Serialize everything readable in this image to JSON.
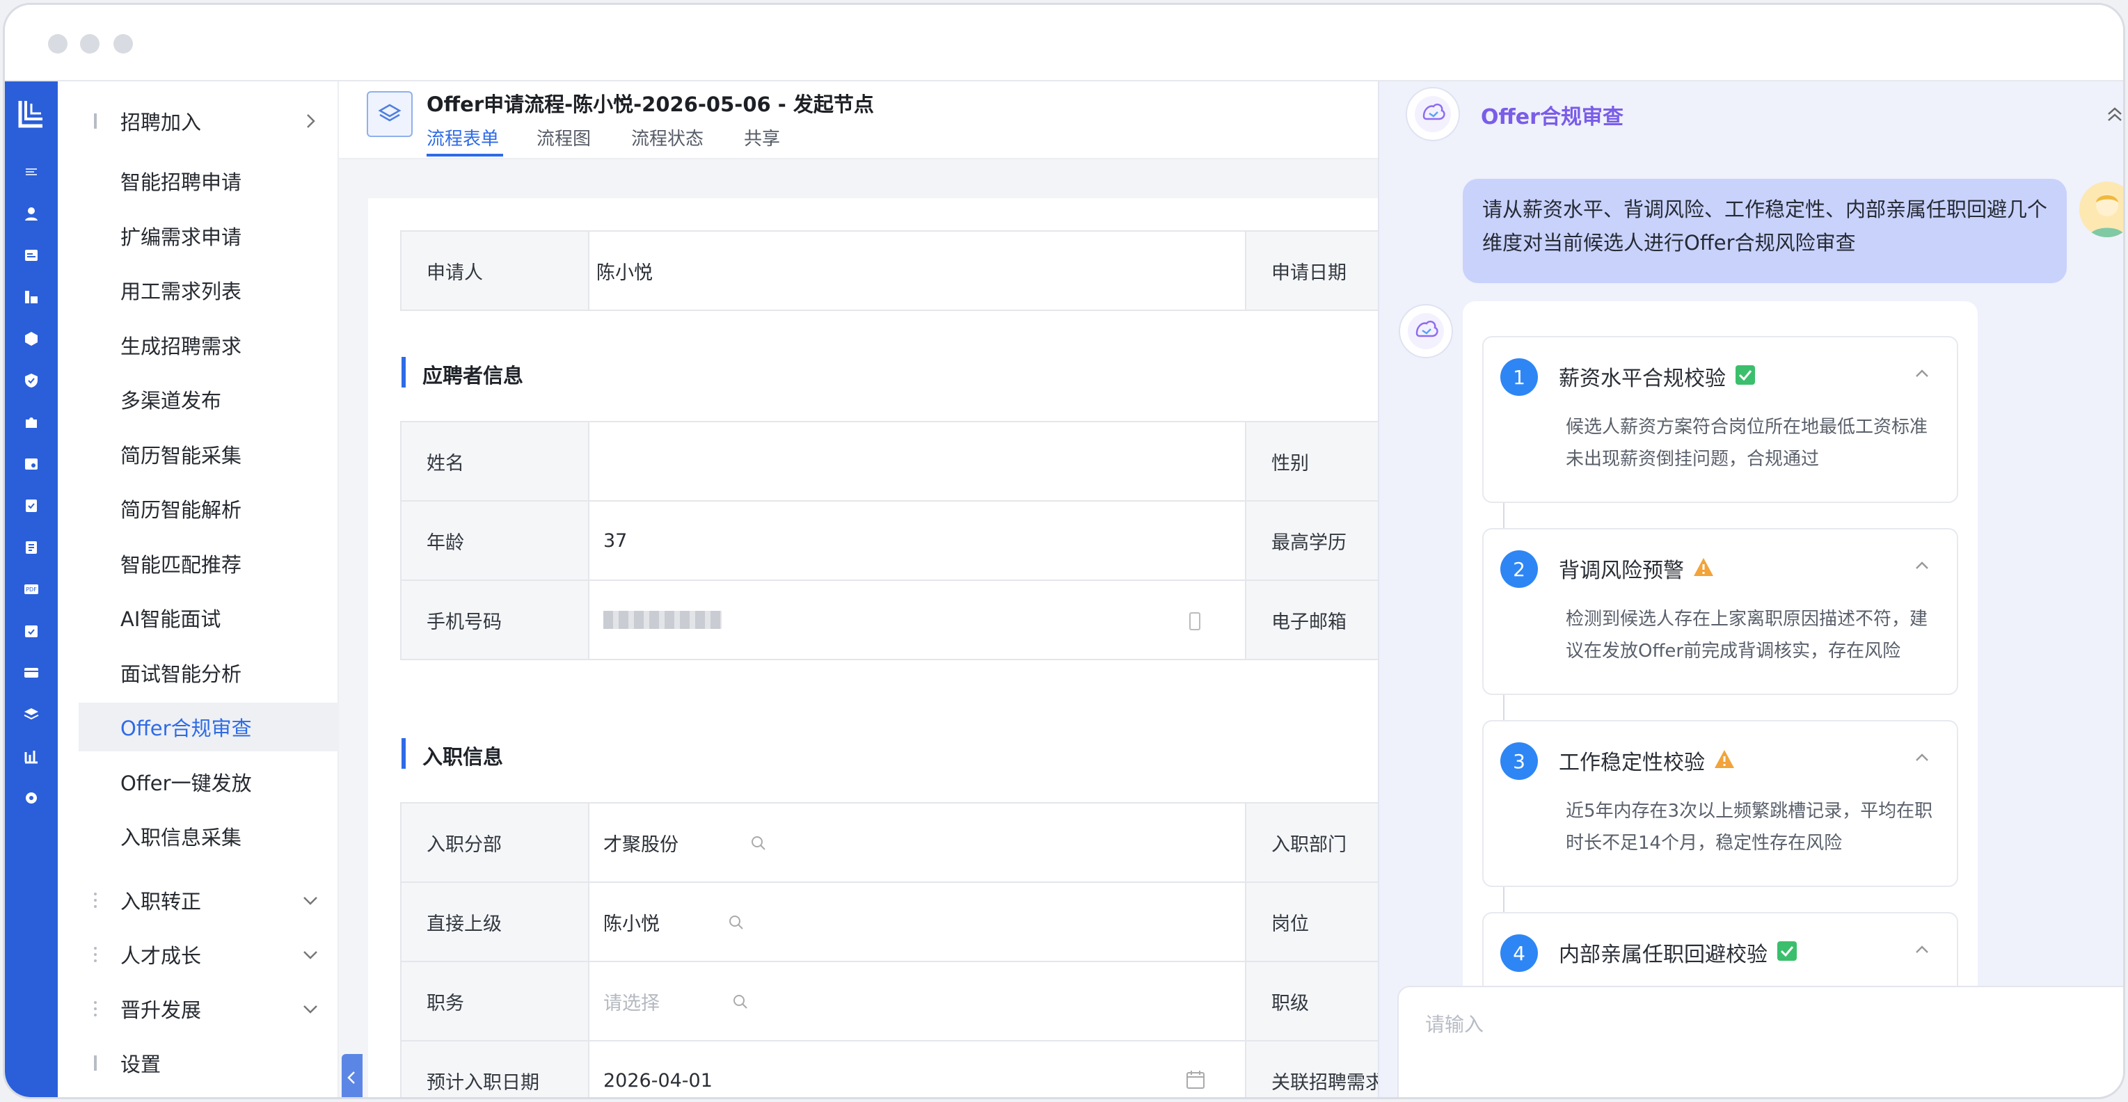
{
  "window": {
    "controls": [
      "close",
      "minimize",
      "maximize"
    ]
  },
  "rail": {
    "icons": [
      "logo-icon",
      "menu-icon",
      "user-icon",
      "id-card-icon",
      "org-chart-icon",
      "box-icon",
      "shield-icon",
      "puzzle-icon",
      "calendar-search-icon",
      "checklist-icon",
      "document-icon",
      "pdf-icon",
      "calendar-check-icon",
      "card-icon",
      "layers-icon",
      "bar-chart-icon",
      "gear-icon"
    ]
  },
  "sidebar": {
    "group_recruit": "招聘加入",
    "items": [
      "智能招聘申请",
      "扩编需求申请",
      "用工需求列表",
      "生成招聘需求",
      "多渠道发布",
      "简历智能采集",
      "简历智能解析",
      "智能匹配推荐",
      "AI智能面试",
      "面试智能分析",
      "Offer合规审查",
      "Offer一键发放",
      "入职信息采集"
    ],
    "active_item": "Offer合规审查",
    "groups": [
      "入职转正",
      "人才成长",
      "晋升发展",
      "设置"
    ]
  },
  "header": {
    "title": "Offer申请流程-陈小悦-2026-05-06 - 发起节点",
    "tabs": [
      "流程表单",
      "流程图",
      "流程状态",
      "共享"
    ],
    "active_tab": "流程表单"
  },
  "form": {
    "applicant_label": "申请人",
    "applicant_value": "陈小悦",
    "apply_date_label": "申请日期",
    "section_candidate": "应聘者信息",
    "name_label": "姓名",
    "gender_label": "性别",
    "age_label": "年龄",
    "age_value": "37",
    "education_label": "最高学历",
    "phone_label": "手机号码",
    "email_label": "电子邮箱",
    "section_onboard": "入职信息",
    "branch_label": "入职分部",
    "branch_value": "才聚股份",
    "dept_label": "入职部门",
    "supervisor_label": "直接上级",
    "supervisor_value": "陈小悦",
    "position_label": "岗位",
    "duty_label": "职务",
    "duty_placeholder": "请选择",
    "level_label": "职级",
    "entry_date_label": "预计入职日期",
    "entry_date_value": "2026-04-01",
    "related_demand_label": "关联招聘需求"
  },
  "panel": {
    "title": "Offer合规审查",
    "user_message": "请从薪资水平、背调风险、工作稳定性、内部亲属任职回避几个维度对当前候选人进行Offer合规风险审查",
    "steps": [
      {
        "num": "1",
        "title": "薪资水平合规校验",
        "status": "pass",
        "desc": "候选人薪资方案符合岗位所在地最低工资标准未出现薪资倒挂问题，合规通过"
      },
      {
        "num": "2",
        "title": "背调风险预警",
        "status": "warning",
        "desc": "检测到候选人存在上家离职原因描述不符，建议在发放Offer前完成背调核实，存在风险"
      },
      {
        "num": "3",
        "title": "工作稳定性校验",
        "status": "warning",
        "desc": "近5年内存在3次以上频繁跳槽记录，平均在职时长不足14个月，稳定性存在风险"
      },
      {
        "num": "4",
        "title": "内部亲属任职回避校验",
        "status": "pass",
        "desc": ""
      }
    ],
    "input_placeholder": "请输入"
  },
  "colors": {
    "rail": "#2b5fd9",
    "accent": "#2e6be6",
    "panel_title": "#7a5de8",
    "pass": "#3bbf6c",
    "warning": "#f2a33a"
  }
}
